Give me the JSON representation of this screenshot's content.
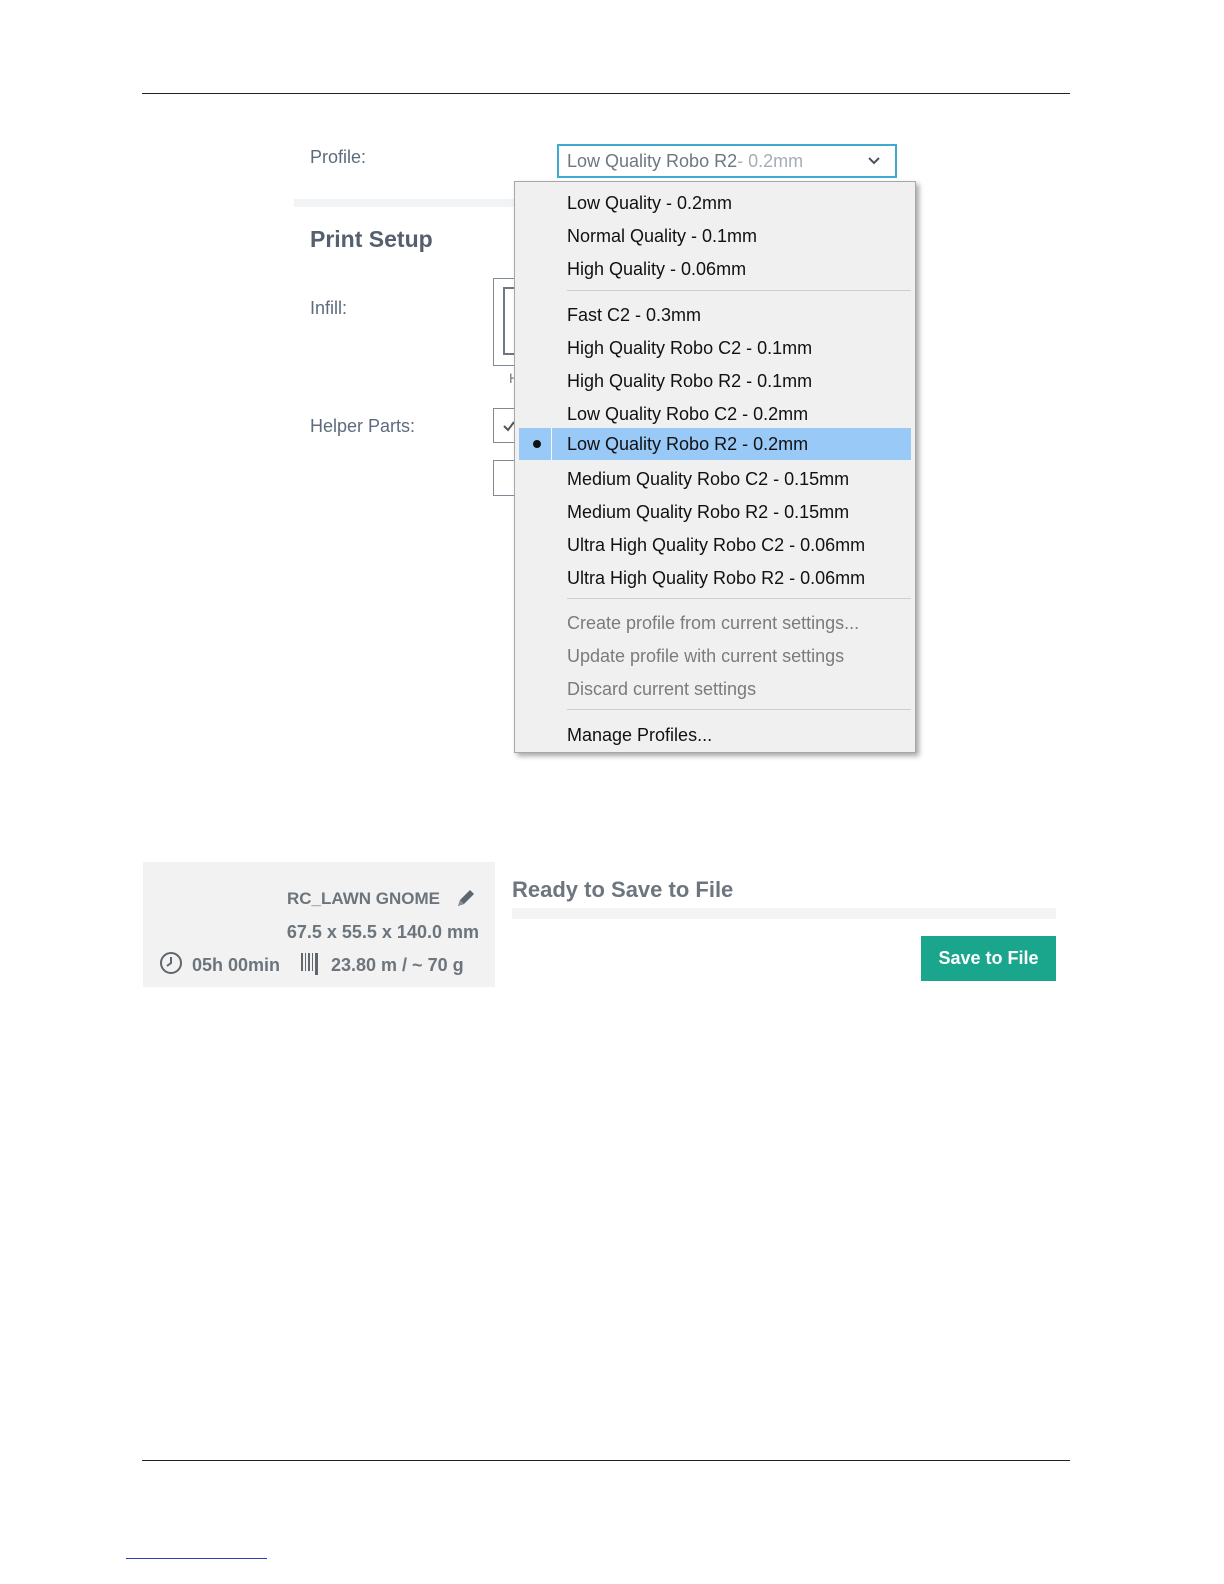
{
  "profile": {
    "label": "Profile:",
    "selected_name": "Low Quality Robo R2",
    "selected_suffix": " - 0.2mm"
  },
  "print_setup": {
    "title": "Print Setup",
    "infill_label": "Infill:",
    "helper_parts_label": "Helper Parts:",
    "infill_hidden_char": "H"
  },
  "menu": {
    "group1": [
      "Low Quality - 0.2mm",
      "Normal Quality - 0.1mm",
      "High Quality - 0.06mm"
    ],
    "group2": [
      "Fast C2 - 0.3mm",
      "High Quality Robo C2 - 0.1mm",
      "High Quality Robo R2 - 0.1mm",
      "Low Quality Robo C2 - 0.2mm",
      "Low Quality Robo R2 - 0.2mm",
      "Medium Quality Robo C2 - 0.15mm",
      "Medium Quality Robo R2 - 0.15mm",
      "Ultra High Quality Robo C2 - 0.06mm",
      "Ultra High Quality Robo R2 - 0.06mm"
    ],
    "group3": [
      "Create profile from current settings...",
      "Update profile with current settings",
      "Discard current settings"
    ],
    "group4": [
      "Manage Profiles..."
    ],
    "selected_item": "Low Quality Robo R2 - 0.2mm"
  },
  "job": {
    "name": "RC_LAWN GNOME",
    "dimensions": "67.5 x 55.5 x 140.0 mm",
    "time": "05h 00min",
    "material": "23.80 m / ~ 70 g"
  },
  "status": {
    "title": "Ready to Save to File",
    "save_label": "Save to File"
  },
  "colors": {
    "accent_green": "#1aa58d",
    "select_border": "#3fa9d1",
    "menu_highlight": "#99c9f7"
  },
  "icons": [
    "chevron-down-icon",
    "selected-dot-icon",
    "pencil-icon",
    "clock-icon",
    "filament-icon",
    "checkmark-icon"
  ]
}
